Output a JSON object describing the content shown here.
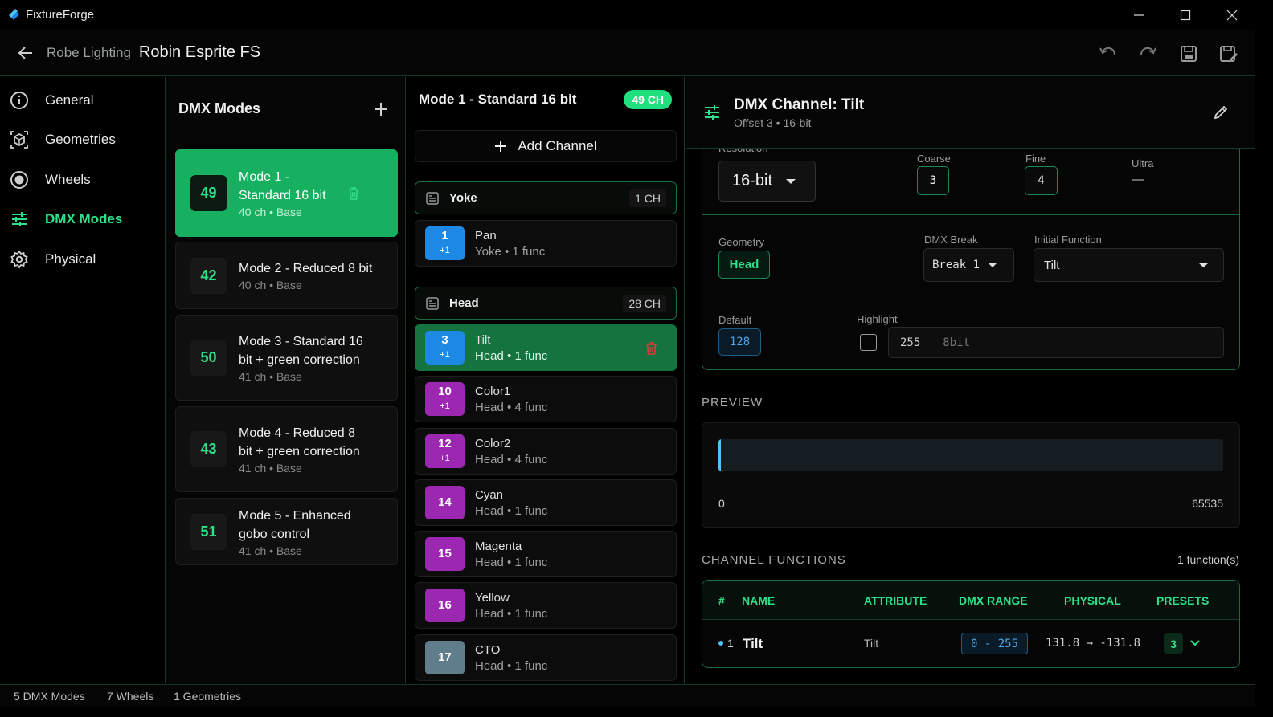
{
  "app": {
    "title": "FixtureForge"
  },
  "header": {
    "brand": "Robe Lighting",
    "model": "Robin Esprite FS"
  },
  "nav": {
    "items": [
      {
        "label": "General",
        "icon": "info-icon"
      },
      {
        "label": "Geometries",
        "icon": "cube-icon"
      },
      {
        "label": "Wheels",
        "icon": "wheel-icon"
      },
      {
        "label": "DMX Modes",
        "icon": "sliders-icon",
        "active": true
      },
      {
        "label": "Physical",
        "icon": "gear-icon"
      }
    ]
  },
  "modes": {
    "title": "DMX Modes",
    "items": [
      {
        "count": "49",
        "name": "Mode 1 - Standard 16 bit",
        "sub": "40 ch • Base",
        "active": true
      },
      {
        "count": "42",
        "name": "Mode 2 - Reduced 8 bit",
        "sub": "40 ch • Base"
      },
      {
        "count": "50",
        "name": "Mode 3 - Standard 16 bit + green correction",
        "sub": "41 ch • Base"
      },
      {
        "count": "43",
        "name": "Mode 4 - Reduced 8 bit + green correction",
        "sub": "41 ch • Base"
      },
      {
        "count": "51",
        "name": "Mode 5 - Enhanced gobo control",
        "sub": "41 ch • Base"
      }
    ]
  },
  "channels": {
    "title": "Mode 1 - Standard 16 bit",
    "pill": "49 CH",
    "add_label": "Add Channel",
    "groups": [
      {
        "name": "Yoke",
        "count": "1 CH"
      },
      {
        "name": "Head",
        "count": "28 CH"
      }
    ],
    "items": [
      {
        "num": "1",
        "plus": "+1",
        "name": "Pan",
        "sub": "Yoke • 1 func",
        "color": "#1e88e5"
      },
      {
        "num": "3",
        "plus": "+1",
        "name": "Tilt",
        "sub": "Head • 1 func",
        "color": "#1e88e5",
        "active": true
      },
      {
        "num": "10",
        "plus": "+1",
        "name": "Color1",
        "sub": "Head • 4 func",
        "color": "#9c27b0"
      },
      {
        "num": "12",
        "plus": "+1",
        "name": "Color2",
        "sub": "Head • 4 func",
        "color": "#9c27b0"
      },
      {
        "num": "14",
        "plus": "",
        "name": "Cyan",
        "sub": "Head • 1 func",
        "color": "#9c27b0"
      },
      {
        "num": "15",
        "plus": "",
        "name": "Magenta",
        "sub": "Head • 1 func",
        "color": "#9c27b0"
      },
      {
        "num": "16",
        "plus": "",
        "name": "Yellow",
        "sub": "Head • 1 func",
        "color": "#9c27b0"
      },
      {
        "num": "17",
        "plus": "",
        "name": "CTO",
        "sub": "Head • 1 func",
        "color": "#607d8b"
      }
    ]
  },
  "detail": {
    "title": "DMX Channel: Tilt",
    "subtitle": "Offset 3 • 16-bit",
    "resolution": {
      "label": "Resolution",
      "value": "16-bit"
    },
    "coarse": {
      "label": "Coarse",
      "value": "3"
    },
    "fine": {
      "label": "Fine",
      "value": "4"
    },
    "ultra": {
      "label": "Ultra",
      "value": "—"
    },
    "geometry": {
      "label": "Geometry",
      "value": "Head"
    },
    "dmx_break": {
      "label": "DMX Break",
      "value": "Break 1"
    },
    "initial_function": {
      "label": "Initial Function",
      "value": "Tilt"
    },
    "default": {
      "label": "Default",
      "value": "128"
    },
    "highlight": {
      "label": "Highlight",
      "value": "255",
      "unit": "8bit"
    },
    "preview": {
      "title": "PREVIEW",
      "min": "0",
      "max": "65535",
      "level": 0.002
    },
    "functions": {
      "title": "CHANNEL FUNCTIONS",
      "count": "1 function(s)",
      "columns": [
        "#",
        "NAME",
        "ATTRIBUTE",
        "DMX RANGE",
        "PHYSICAL",
        "PRESETS"
      ],
      "rows": [
        {
          "index": "1",
          "name": "Tilt",
          "attribute": "Tilt",
          "range": "0 - 255",
          "physical": "131.8 → -131.8",
          "presets": "3"
        }
      ]
    }
  },
  "status": {
    "modes": "5 DMX Modes",
    "wheels": "7 Wheels",
    "geometries": "1 Geometries"
  },
  "colors": {
    "accent": "#2ee08a",
    "active_mode": "#17b060",
    "active_channel": "#14733f",
    "border": "#1a6a44"
  }
}
